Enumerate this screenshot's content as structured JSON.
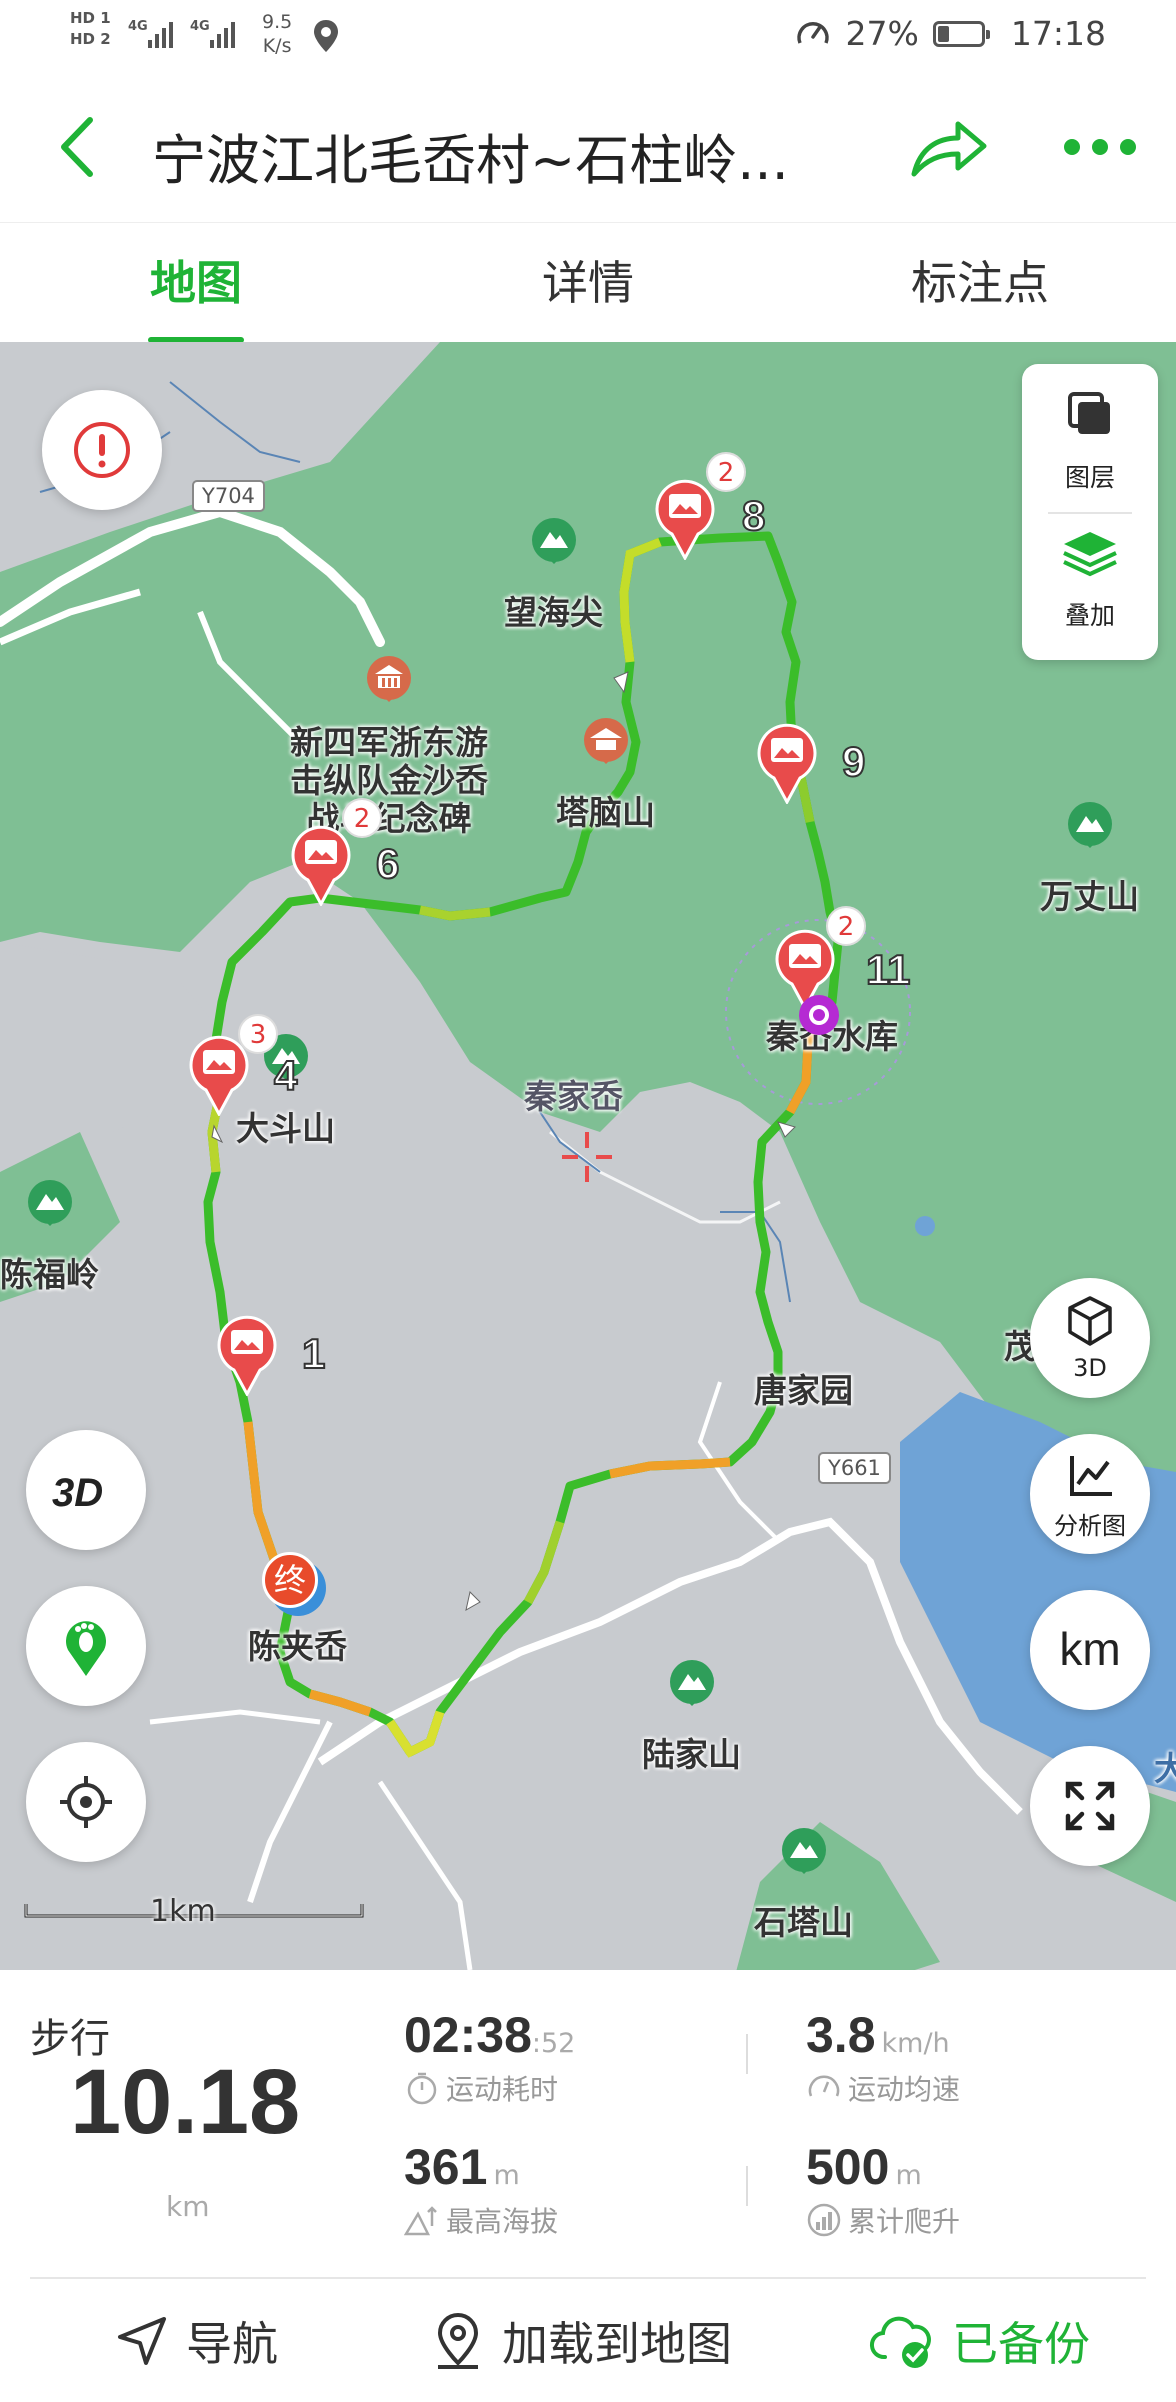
{
  "status_bar": {
    "hd1": "HD 1",
    "hd2": "HD 2",
    "net1": "4G",
    "net2": "4G",
    "speed_value": "9.5",
    "speed_unit": "K/s",
    "battery": "27%",
    "battery_level": 0.27,
    "time": "17:18"
  },
  "header": {
    "title": "宁波江北毛岙村~石柱岭...",
    "back_icon": "chevron-left-icon",
    "share_icon": "share-icon",
    "more_icon": "more-dots-icon"
  },
  "tabs": [
    {
      "label": "地图",
      "active": true
    },
    {
      "label": "详情",
      "active": false
    },
    {
      "label": "标注点",
      "active": false
    }
  ],
  "map": {
    "roads": [
      "Y704",
      "Y661"
    ],
    "places": [
      {
        "name": "望海尖",
        "type": "mountain"
      },
      {
        "name": "新四军浙东游击纵队金沙岙战斗纪念碑",
        "line1": "新四军浙东游",
        "line2": "击纵队金沙岙",
        "line3": "战斗纪念碑",
        "type": "monument"
      },
      {
        "name": "塔脑山",
        "type": "temple"
      },
      {
        "name": "万丈山",
        "type": "mountain"
      },
      {
        "name": "秦岙水库",
        "type": "reservoir"
      },
      {
        "name": "大斗山",
        "type": "mountain"
      },
      {
        "name": "秦家岙",
        "type": "village"
      },
      {
        "name": "陈福岭",
        "type": "mountain"
      },
      {
        "name": "唐家园",
        "type": "village"
      },
      {
        "name": "陈夹岙",
        "type": "village"
      },
      {
        "name": "陆家山",
        "type": "mountain"
      },
      {
        "name": "石塔山",
        "type": "mountain"
      },
      {
        "name": "茂",
        "type": "partial"
      },
      {
        "name": "大",
        "type": "partial"
      }
    ],
    "markers": [
      {
        "number": "1",
        "photos": ""
      },
      {
        "number": "4",
        "photos": "3"
      },
      {
        "number": "6",
        "photos": "2"
      },
      {
        "number": "8",
        "photos": "2"
      },
      {
        "number": "9",
        "photos": ""
      },
      {
        "number": "11",
        "photos": "2"
      }
    ],
    "end_marker": "终",
    "scale_label": "1km",
    "layer_panel": {
      "layers_label": "图层",
      "overlay_label": "叠加"
    },
    "buttons": {
      "warning_icon": "alert-icon",
      "btn_3d_label": "3D",
      "analysis_label": "分析图",
      "km_label": "km",
      "fullscreen_icon": "expand-icon",
      "footprint_icon": "footprint-icon",
      "locate_icon": "locate-icon",
      "threed_icon": "3d-view-icon"
    }
  },
  "stats": {
    "mode": "步行",
    "distance": "10.18",
    "distance_unit": "km",
    "duration": "02:38",
    "duration_sec": ":52",
    "duration_label": "运动耗时",
    "avg_speed": "3.8",
    "avg_speed_unit": "km/h",
    "avg_speed_label": "运动均速",
    "max_altitude": "361",
    "max_altitude_unit": "m",
    "max_altitude_label": "最高海拔",
    "climb": "500",
    "climb_unit": "m",
    "climb_label": "累计爬升"
  },
  "bottom_bar": {
    "navigate": "导航",
    "load_to_map": "加载到地图",
    "backed_up": "已备份"
  },
  "colors": {
    "accent": "#1fb336",
    "forest": "#7fbf94",
    "land": "#c8cbcf",
    "water": "#6fa3d6",
    "marker": "#e84b4b"
  }
}
